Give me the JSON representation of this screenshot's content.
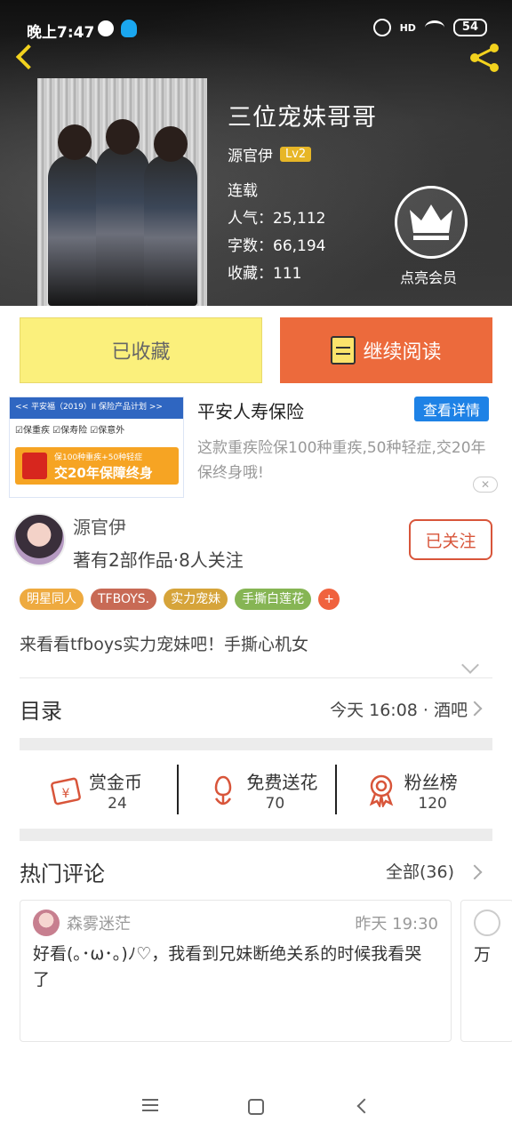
{
  "status": {
    "time": "晚上7:47",
    "battery": "54",
    "signal": "HD"
  },
  "book": {
    "title": "三位宠妹哥哥",
    "author": "源官伊",
    "level": "Lv2",
    "state": "连载",
    "popularity": "人气：25,112",
    "words": "字数：66,194",
    "favorites": "收藏：111",
    "vip_label": "点亮会员"
  },
  "actions": {
    "fav_label": "已收藏",
    "read_label": "继续阅读"
  },
  "ad": {
    "title": "平安人寿保险",
    "detail_label": "查看详情",
    "desc": "这款重疾险保100种重疾,50种轻症,交20年保终身哦!",
    "close": "✕",
    "image_top": "<< 平安福（2019）II 保险产品计划 >>",
    "image_checks": "☑保重疾 ☑保寿险 ☑保意外",
    "image_small": "保100种重疾+50种轻症",
    "image_big": "交20年保障终身"
  },
  "author": {
    "name": "源官伊",
    "stats": "著有2部作品·8人关注",
    "follow_label": "已关注"
  },
  "tags": [
    {
      "label": "明星同人",
      "color": "#eeaa3f"
    },
    {
      "label": "TFBOYS.",
      "color": "#c86a55"
    },
    {
      "label": "实力宠妹",
      "color": "#d6a43a"
    },
    {
      "label": "手撕白莲花",
      "color": "#86b554"
    }
  ],
  "tag_add": "+",
  "intro": "来看看tfboys实力宠妹吧！手撕心机女",
  "toc": {
    "title": "目录",
    "latest": "今天 16:08 · 酒吧"
  },
  "stats": [
    {
      "label": "赏金币",
      "value": "24",
      "icon": "reward-coin-icon"
    },
    {
      "label": "免费送花",
      "value": "70",
      "icon": "flower-icon"
    },
    {
      "label": "粉丝榜",
      "value": "120",
      "icon": "medal-icon"
    }
  ],
  "comments": {
    "title": "热门评论",
    "all": "全部(36)",
    "items": [
      {
        "user": "森雾迷茫",
        "time": "昨天 19:30",
        "text": "好看(｡･ω･｡)ﾉ♡，我看到兄妹断绝关系的时候我看哭了"
      },
      {
        "text": "万"
      }
    ]
  },
  "colors": {
    "accent_yellow": "#f2d21e",
    "read_orange": "#ec6a3c",
    "fav_yellow": "#fbf07c",
    "follow_red": "#d8553a"
  }
}
